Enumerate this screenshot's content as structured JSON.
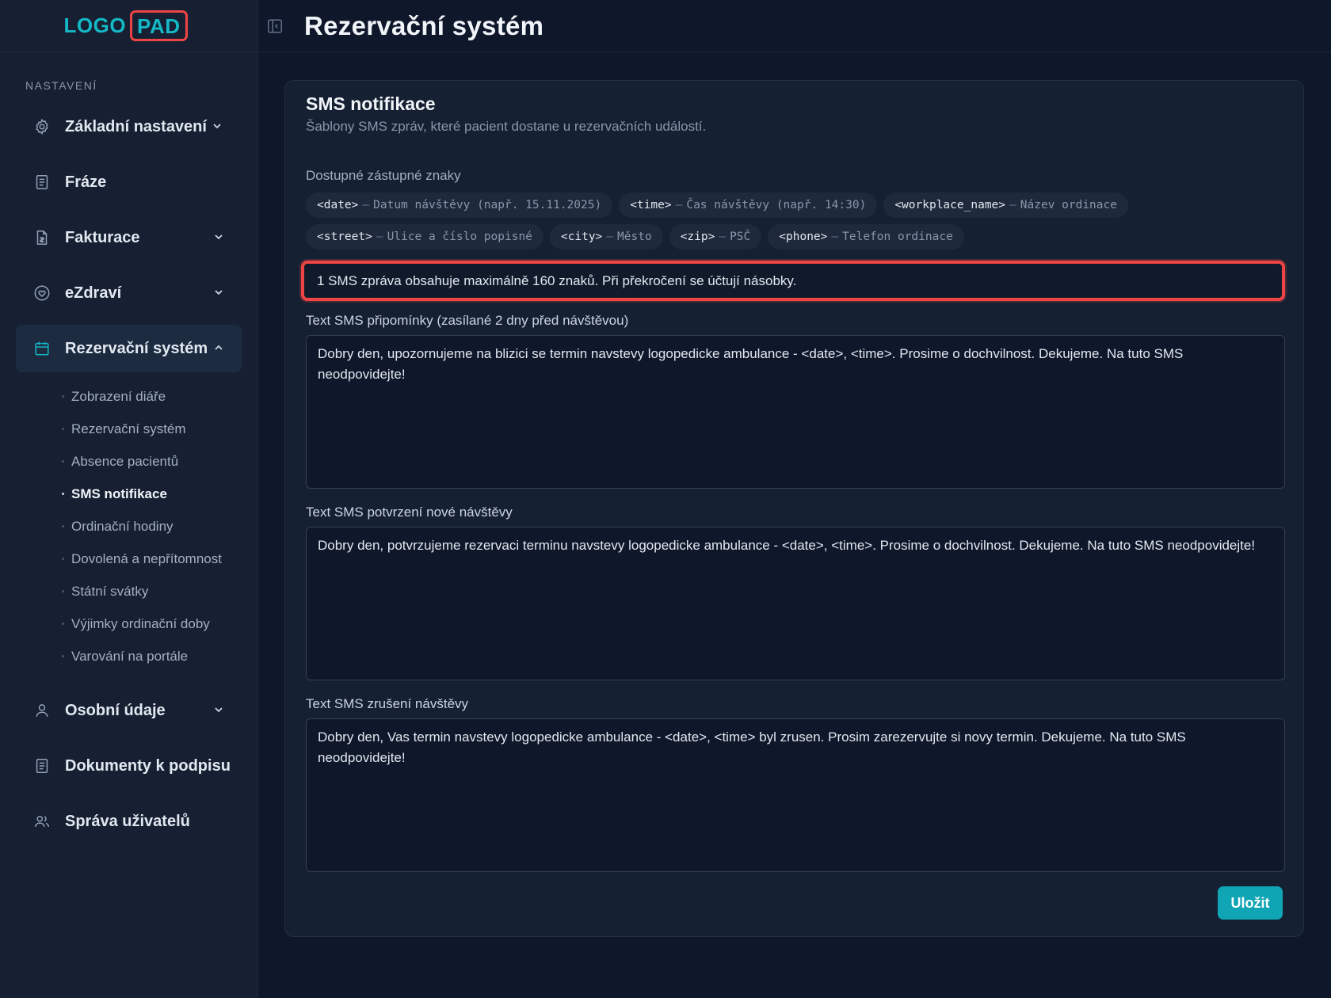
{
  "logo": {
    "part1": "LOGO",
    "part2": "PAD"
  },
  "header": {
    "title": "Rezervační systém"
  },
  "sidebar": {
    "section_label": "NASTAVENÍ",
    "items": [
      {
        "label": "Základní nastavení",
        "icon": "gear-icon"
      },
      {
        "label": "Fráze",
        "icon": "document-icon"
      },
      {
        "label": "Fakturace",
        "icon": "invoice-icon"
      },
      {
        "label": "eZdraví",
        "icon": "heart-icon"
      },
      {
        "label": "Rezervační systém",
        "icon": "calendar-icon"
      },
      {
        "label": "Osobní údaje",
        "icon": "user-icon"
      },
      {
        "label": "Dokumenty k podpisu",
        "icon": "document-icon"
      },
      {
        "label": "Správa uživatelů",
        "icon": "users-icon"
      }
    ],
    "sub_items": [
      "Zobrazení diáře",
      "Rezervační systém",
      "Absence pacientů",
      "SMS notifikace",
      "Ordinační hodiny",
      "Dovolená a nepřítomnost",
      "Státní svátky",
      "Výjimky ordinační doby",
      "Varování na portále"
    ],
    "current_sub": "SMS notifikace"
  },
  "card": {
    "title": "SMS notifikace",
    "subtitle": "Šablony SMS zpráv, které pacient dostane u rezervačních událostí.",
    "placeholders_label": "Dostupné zástupné znaky",
    "placeholders": [
      {
        "token": "<date>",
        "desc": "Datum návštěvy (např. 15.11.2025)"
      },
      {
        "token": "<time>",
        "desc": "Čas návštěvy (např. 14:30)"
      },
      {
        "token": "<workplace_name>",
        "desc": "Název ordinace"
      },
      {
        "token": "<street>",
        "desc": "Ulice a číslo popisné"
      },
      {
        "token": "<city>",
        "desc": "Město"
      },
      {
        "token": "<zip>",
        "desc": "PSČ"
      },
      {
        "token": "<phone>",
        "desc": "Telefon ordinace"
      }
    ],
    "dash": "–",
    "info": "1 SMS zpráva obsahuje maximálně 160 znaků. Při překročení se účtují násobky.",
    "fields": [
      {
        "label": "Text SMS připomínky (zasílané 2 dny před návštěvou)",
        "value": "Dobry den, upozornujeme na blizici se termin navstevy logopedicke ambulance - <date>, <time>. Prosime o dochvilnost. Dekujeme. Na tuto SMS neodpovidejte!"
      },
      {
        "label": "Text SMS potvrzení nové návštěvy",
        "value": "Dobry den, potvrzujeme rezervaci terminu navstevy logopedicke ambulance - <date>, <time>. Prosime o dochvilnost. Dekujeme. Na tuto SMS neodpovidejte!"
      },
      {
        "label": "Text SMS zrušení návštěvy",
        "value": "Dobry den, Vas termin navstevy logopedicke ambulance - <date>, <time> byl zrusen. Prosim zarezervujte si novy termin. Dekujeme. Na tuto SMS neodpovidejte!"
      }
    ],
    "save_label": "Uložit"
  },
  "colors": {
    "accent": "#14b8c6",
    "highlight": "#ef4444",
    "background": "#0f172a"
  }
}
